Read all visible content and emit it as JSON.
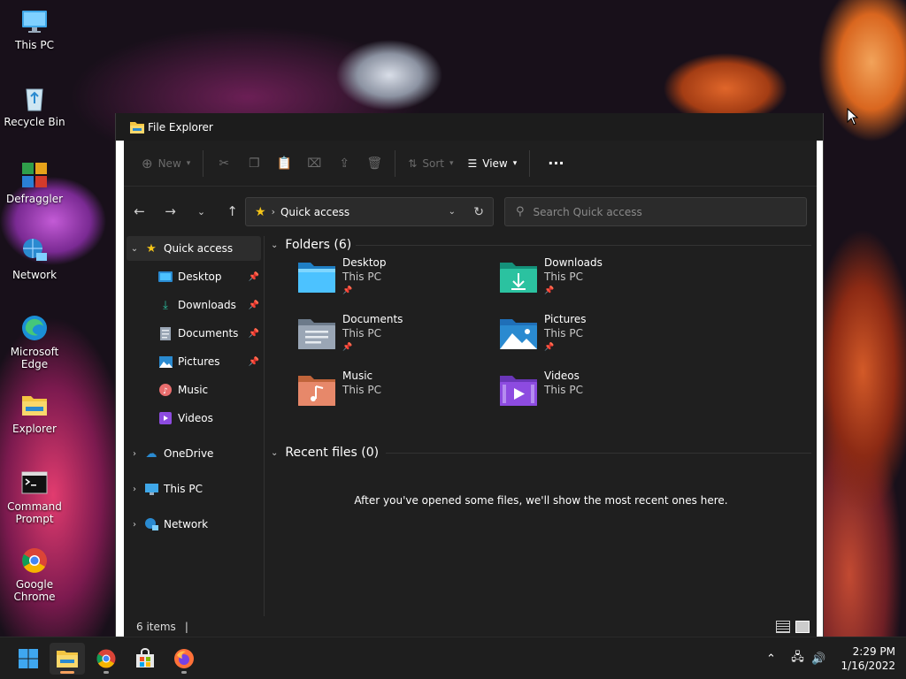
{
  "desktop": {
    "icons": [
      {
        "label": "This PC",
        "icon": "monitor-icon"
      },
      {
        "label": "Recycle Bin",
        "icon": "recycle-bin-icon"
      },
      {
        "label": "Defraggler",
        "icon": "defraggler-icon"
      },
      {
        "label": "Network",
        "icon": "network-icon"
      },
      {
        "label": "Microsoft Edge",
        "icon": "edge-icon"
      },
      {
        "label": "Explorer",
        "icon": "folder-icon"
      },
      {
        "label": "Command Prompt",
        "icon": "command-prompt-icon"
      },
      {
        "label": "Google Chrome",
        "icon": "chrome-icon"
      }
    ]
  },
  "window": {
    "title": "File Explorer",
    "toolbar": {
      "new_label": "New",
      "sort_label": "Sort",
      "view_label": "View",
      "more_label": "···"
    },
    "address": {
      "location": "Quick access"
    },
    "search": {
      "placeholder": "Search Quick access"
    },
    "sidebar": {
      "quick_access": "Quick access",
      "pinned": [
        {
          "label": "Desktop",
          "pinned": true
        },
        {
          "label": "Downloads",
          "pinned": true
        },
        {
          "label": "Documents",
          "pinned": true
        },
        {
          "label": "Pictures",
          "pinned": true
        },
        {
          "label": "Music",
          "pinned": false
        },
        {
          "label": "Videos",
          "pinned": false
        }
      ],
      "onedrive": "OneDrive",
      "this_pc": "This PC",
      "network": "Network"
    },
    "main": {
      "folders_header": "Folders (6)",
      "folders": [
        {
          "name": "Desktop",
          "location": "This PC",
          "pinned": true
        },
        {
          "name": "Downloads",
          "location": "This PC",
          "pinned": true
        },
        {
          "name": "Documents",
          "location": "This PC",
          "pinned": true
        },
        {
          "name": "Pictures",
          "location": "This PC",
          "pinned": true
        },
        {
          "name": "Music",
          "location": "This PC",
          "pinned": false
        },
        {
          "name": "Videos",
          "location": "This PC",
          "pinned": false
        }
      ],
      "recent_header": "Recent files (0)",
      "recent_empty": "After you've opened some files, we'll show the most recent ones here."
    },
    "status": {
      "items": "6 items"
    }
  },
  "taskbar": {
    "time": "2:29 PM",
    "date": "1/16/2022",
    "apps": [
      "start-icon",
      "file-explorer-icon",
      "chrome-icon",
      "store-icon",
      "firefox-icon"
    ]
  },
  "colors": {
    "accent": "#f5c518",
    "window_bg": "#202020",
    "folder_blue": "#4cc2ff",
    "folder_teal": "#2bc2a0"
  }
}
